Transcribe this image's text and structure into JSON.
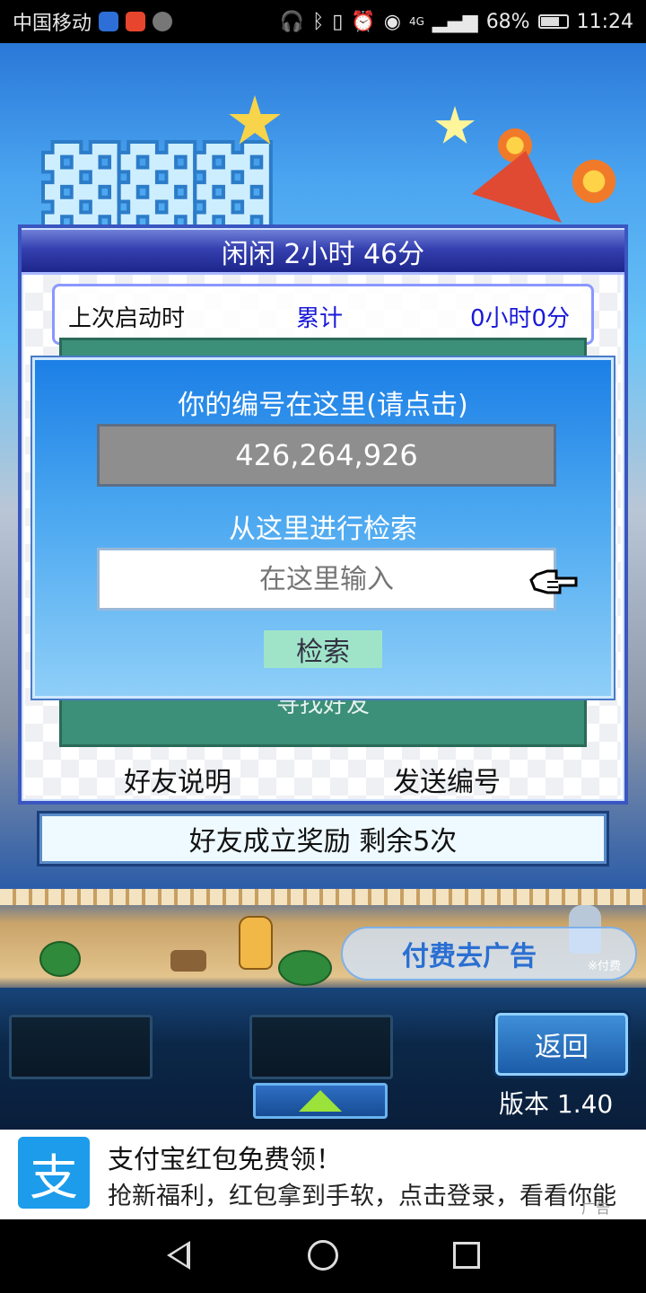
{
  "status_bar": {
    "carrier": "中国移动",
    "network": "4G",
    "battery": "68%",
    "time": "11:24"
  },
  "panel": {
    "title": "闲闲  2小时 46分",
    "last_launch_label": "上次启动时",
    "total_label": "累计",
    "total_value": "0小时0分",
    "find_friend": "寻找好友",
    "friend_help": "好友说明",
    "send_id": "发送编号"
  },
  "dialog": {
    "id_title": "你的编号在这里(请点击)",
    "id_value": "426,264,926",
    "search_title": "从这里进行检索",
    "search_placeholder": "在这里输入",
    "search_button": "检索"
  },
  "reward_bar": "好友成立奖励  剩余5次",
  "ad_remove": {
    "label": "付费去广告",
    "note": "※付费"
  },
  "game_bar": {
    "back_button": "返回",
    "version": "版本 1.40"
  },
  "banner": {
    "logo_char": "支",
    "title": "支付宝红包免费领！",
    "subtitle": "抢新福利，红包拿到手软，点击登录，看看你能",
    "ad_tag": "广告"
  },
  "colors": {
    "dialog_blue": "#1c7fe6",
    "panel_border": "#3a56c0",
    "teal": "#3c8f78",
    "search_button_bg": "#9fe4c9",
    "alipay_blue": "#1c9cea"
  }
}
